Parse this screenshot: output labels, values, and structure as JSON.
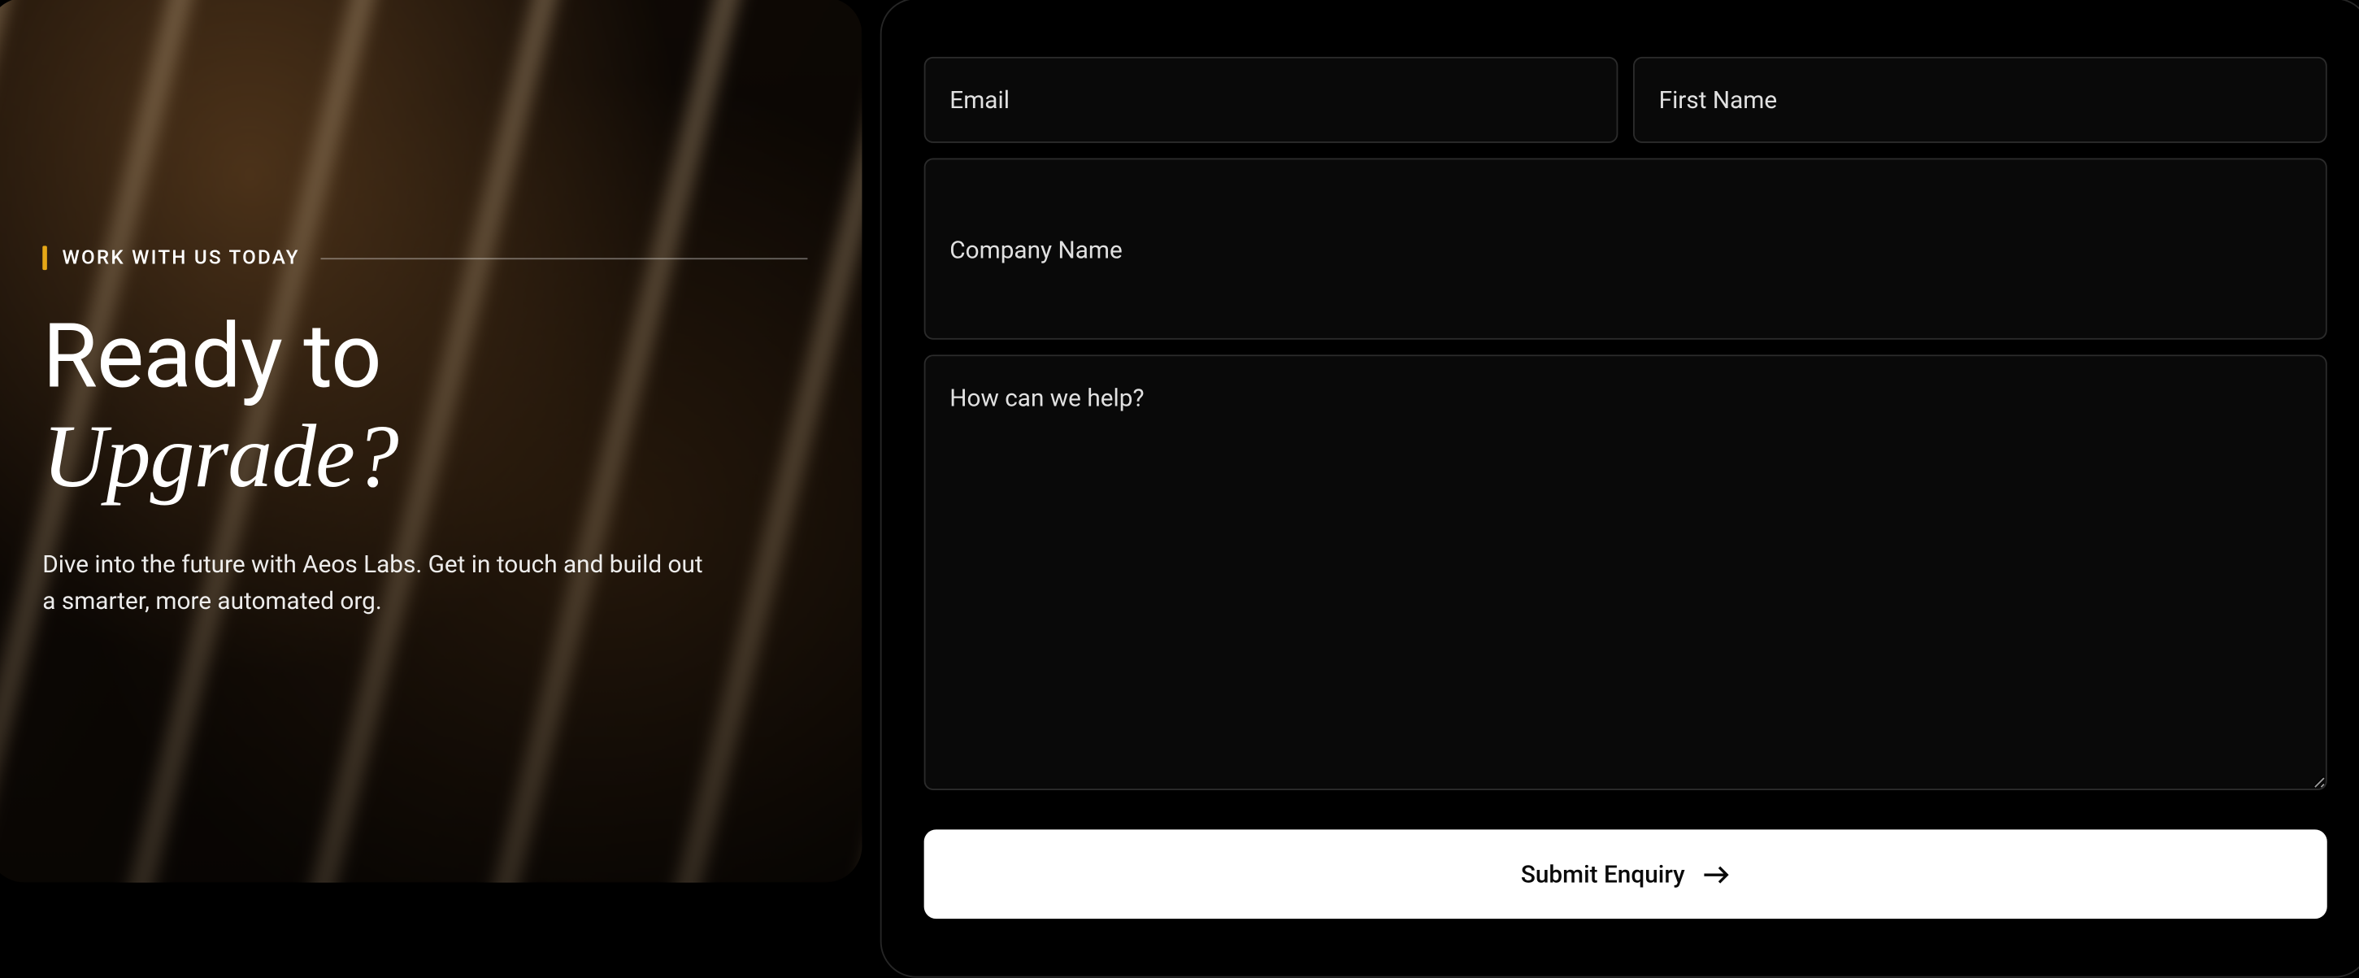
{
  "left": {
    "eyebrow": "WORK WITH US TODAY",
    "heading_line1": "Ready to",
    "heading_line2": "Upgrade?",
    "description": "Dive into the future with Aeos Labs. Get in touch and build out a smarter, more automated org."
  },
  "form": {
    "email_placeholder": "Email",
    "first_name_placeholder": "First Name",
    "company_placeholder": "Company Name",
    "message_placeholder": "How can we help?",
    "submit_label": "Submit Enquiry"
  }
}
